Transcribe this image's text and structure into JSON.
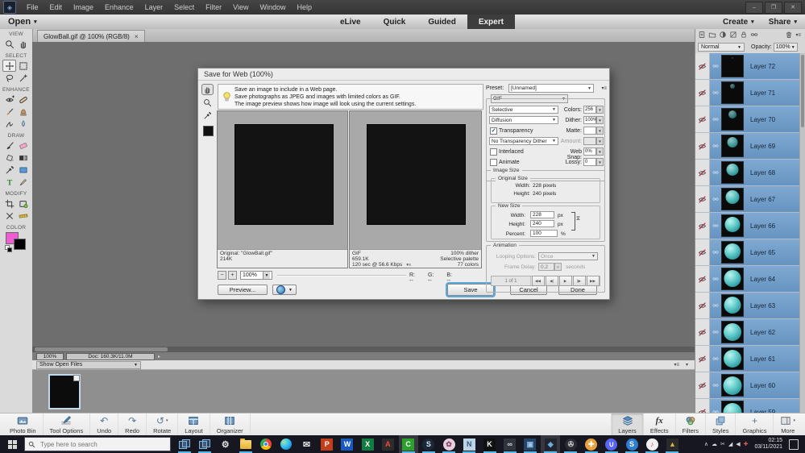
{
  "colors": {
    "accent_blue": "#5aa7dc",
    "layer_selection_blue": "#6f9dc9",
    "ball_teal": "#4fc3c3",
    "foreground_swatch": "#ee5ed2",
    "background_swatch": "#000000",
    "taskbar_background": "#171722"
  },
  "titlebar": {
    "menus": [
      "File",
      "Edit",
      "Image",
      "Enhance",
      "Layer",
      "Select",
      "Filter",
      "View",
      "Window",
      "Help"
    ],
    "window_controls": [
      {
        "name": "minimize-button",
        "glyph": "–"
      },
      {
        "name": "restore-button",
        "glyph": "❐"
      },
      {
        "name": "close-button",
        "glyph": "✕"
      }
    ]
  },
  "mode_bar": {
    "open_label": "Open",
    "tabs": [
      {
        "label": "eLive",
        "active": false
      },
      {
        "label": "Quick",
        "active": false
      },
      {
        "label": "Guided",
        "active": false
      },
      {
        "label": "Expert",
        "active": true
      }
    ],
    "create_label": "Create",
    "share_label": "Share"
  },
  "document_tab": {
    "title": "GlowBall.gif @ 100% (RGB/8)",
    "close_glyph": "×"
  },
  "tools_panel": {
    "sections": [
      {
        "label": "VIEW",
        "tools": [
          {
            "name": "zoom-tool",
            "icon": "magnifier"
          },
          {
            "name": "hand-tool",
            "icon": "hand"
          }
        ]
      },
      {
        "label": "SELECT",
        "tools": [
          {
            "name": "move-tool",
            "icon": "move",
            "selected": true
          },
          {
            "name": "marquee-tool",
            "icon": "marquee"
          },
          {
            "name": "lasso-tool",
            "icon": "lasso"
          },
          {
            "name": "quick-selection-tool",
            "icon": "wand"
          }
        ]
      },
      {
        "label": "ENHANCE",
        "tools": [
          {
            "name": "red-eye-removal-tool",
            "icon": "eye"
          },
          {
            "name": "spot-healing-tool",
            "icon": "bandage"
          },
          {
            "name": "smart-brush-tool",
            "icon": "brush2"
          },
          {
            "name": "clone-stamp-tool",
            "icon": "stamp"
          },
          {
            "name": "smudge-tool",
            "icon": "smudge"
          },
          {
            "name": "blur-tool",
            "icon": "blur"
          }
        ]
      },
      {
        "label": "DRAW",
        "tools": [
          {
            "name": "brush-tool",
            "icon": "brush"
          },
          {
            "name": "eraser-tool",
            "icon": "eraser"
          },
          {
            "name": "paint-bucket-tool",
            "icon": "bucket"
          },
          {
            "name": "gradient-tool",
            "icon": "gradient"
          },
          {
            "name": "eyedropper-tool",
            "icon": "eyedropper"
          },
          {
            "name": "shape-tool",
            "icon": "shape"
          },
          {
            "name": "type-tool",
            "icon": "type"
          },
          {
            "name": "pencil-tool",
            "icon": "pencil"
          }
        ]
      },
      {
        "label": "MODIFY",
        "tools": [
          {
            "name": "crop-tool",
            "icon": "crop"
          },
          {
            "name": "cookie-cutter-tool",
            "icon": "cookie"
          },
          {
            "name": "content-aware-move-tool",
            "icon": "camove"
          },
          {
            "name": "straighten-tool",
            "icon": "ruler"
          }
        ]
      }
    ],
    "color_section_label": "COLOR"
  },
  "dialog": {
    "title": "Save for Web (100%)",
    "info_lines": [
      "Save an image to include in a Web page.",
      "Save photographs as JPEG and images with limited colors as GIF.",
      "The image preview shows how image will look using the current settings."
    ],
    "tools": [
      {
        "name": "hand-tool",
        "icon": "hand",
        "selected": true
      },
      {
        "name": "zoom-tool",
        "icon": "magnifier"
      },
      {
        "name": "eyedropper-tool",
        "icon": "eyedropper"
      }
    ],
    "previews": {
      "original": {
        "lines": [
          "Original: \"GlowBall.gif\"",
          "214K"
        ]
      },
      "optimized": {
        "left_lines": [
          "GIF",
          "659.1K",
          "120 sec @ 56.6 Kbps"
        ],
        "menu_glyph": "▾≡",
        "right_lines": [
          "100% dither",
          "Selective palette",
          "77 colors"
        ]
      }
    },
    "zoom": {
      "minus": "−",
      "plus": "+",
      "value": "100%"
    },
    "rgb": {
      "r_label": "R:",
      "g_label": "G:",
      "b_label": "B:",
      "value": "--"
    },
    "buttons": {
      "preview": "Preview...",
      "save": "Save",
      "cancel": "Cancel",
      "done": "Done"
    },
    "preset": {
      "label": "Preset:",
      "value": "[Unnamed]",
      "menu_glyph": "▾≡"
    },
    "format_value": "GIF",
    "settings_rows": [
      {
        "name": "palette",
        "type": "select",
        "value": "Selective",
        "right_label": "Colors:",
        "right_value": "256"
      },
      {
        "name": "dither-method",
        "type": "select",
        "value": "Diffusion",
        "right_label": "Dither:",
        "right_value": "100%"
      },
      {
        "name": "transparency",
        "type": "checkbox",
        "value": "Transparency",
        "checked": true,
        "right_label": "Matte:",
        "right_value": ""
      },
      {
        "name": "transparency-dither",
        "type": "select",
        "value": "No Transparency Dither",
        "right_label": "Amount:",
        "right_value": "",
        "right_disabled": true
      },
      {
        "name": "interlaced",
        "type": "checkbox",
        "value": "Interlaced",
        "checked": false,
        "right_label": "Web Snap:",
        "right_value": "0%"
      },
      {
        "name": "animate",
        "type": "checkbox",
        "value": "Animate",
        "checked": false,
        "right_label": "Lossy:",
        "right_value": "0"
      }
    ],
    "image_size": {
      "legend": "Image Size",
      "original": {
        "legend": "Original Size",
        "width_label": "Width:",
        "width_value": "228 pixels",
        "height_label": "Height:",
        "height_value": "240 pixels"
      },
      "new": {
        "legend": "New Size",
        "width_label": "Width:",
        "width_value": "228",
        "height_label": "Height:",
        "height_value": "240",
        "unit": "px",
        "percent_label": "Percent:",
        "percent_value": "100",
        "percent_unit": "%"
      }
    },
    "animation": {
      "legend": "Animation",
      "loop_label": "Looping Options:",
      "loop_value": "Once",
      "delay_label": "Frame Delay:",
      "delay_value": "0.2",
      "delay_unit": "seconds",
      "frame_counter": "1 of 1",
      "controls": [
        {
          "name": "first-frame-button",
          "glyph": "◀◀"
        },
        {
          "name": "previous-frame-button",
          "glyph": "◀|"
        },
        {
          "name": "play-button",
          "glyph": "▶"
        },
        {
          "name": "next-frame-button",
          "glyph": "|▶"
        },
        {
          "name": "last-frame-button",
          "glyph": "▶▶"
        }
      ]
    }
  },
  "layers_panel": {
    "header_icons": [
      {
        "name": "new-layer-icon",
        "icon": "newlayer"
      },
      {
        "name": "new-group-icon",
        "icon": "newgroup"
      },
      {
        "name": "adjustment-layer-icon",
        "icon": "adjust"
      },
      {
        "name": "fill-layer-icon",
        "icon": "fill"
      },
      {
        "name": "lock-icon",
        "icon": "lock"
      },
      {
        "name": "link-layers-icon",
        "icon": "chain"
      }
    ],
    "trash_icon_name": "delete-layer-icon",
    "panel_menu_glyph": "▾≡",
    "blend_mode": "Normal",
    "opacity_label": "Opacity:",
    "opacity_value": "100%",
    "layers": [
      {
        "name": "Layer 72",
        "ball": 0.1,
        "glow": 0.28
      },
      {
        "name": "Layer 71",
        "ball": 0.26,
        "glow": 0.5
      },
      {
        "name": "Layer 70",
        "ball": 0.42,
        "glow": 0.65
      },
      {
        "name": "Layer 69",
        "ball": 0.56,
        "glow": 0.8
      },
      {
        "name": "Layer 68",
        "ball": 0.66,
        "glow": 0.9
      },
      {
        "name": "Layer 67",
        "ball": 0.74,
        "glow": 0.95
      },
      {
        "name": "Layer 66",
        "ball": 0.81,
        "glow": 1
      },
      {
        "name": "Layer 65",
        "ball": 0.86,
        "glow": 1
      },
      {
        "name": "Layer 64",
        "ball": 0.9,
        "glow": 1
      },
      {
        "name": "Layer 63",
        "ball": 0.93,
        "glow": 1
      },
      {
        "name": "Layer 62",
        "ball": 0.95,
        "glow": 1
      },
      {
        "name": "Layer 61",
        "ball": 0.97,
        "glow": 1
      },
      {
        "name": "Layer 60",
        "ball": 0.99,
        "glow": 1
      },
      {
        "name": "Layer 59",
        "ball": 1.0,
        "glow": 1
      }
    ]
  },
  "status_bar": {
    "zoom": "100%",
    "doc": "Doc: 160.3K/11.0M",
    "expander_glyph": "▸"
  },
  "photo_bin": {
    "selector_label": "Show Open Files",
    "menu_glyph": "▾≡",
    "collapse_glyph": "▾"
  },
  "pse_taskbar": {
    "left": [
      {
        "name": "photo-bin-button",
        "label": "Photo Bin",
        "icon": "photobin"
      },
      {
        "name": "tool-options-button",
        "label": "Tool Options",
        "icon": "tooloptions"
      },
      {
        "name": "undo-button",
        "label": "Undo",
        "glyph": "↶"
      },
      {
        "name": "redo-button",
        "label": "Redo",
        "glyph": "↷"
      },
      {
        "name": "rotate-button",
        "label": "Rotate",
        "glyph": "↺",
        "caret": true
      },
      {
        "name": "layout-button",
        "label": "Layout",
        "icon": "layout"
      },
      {
        "name": "organizer-button",
        "label": "Organizer",
        "icon": "organizer"
      }
    ],
    "right": [
      {
        "name": "layers-button",
        "label": "Layers",
        "icon": "layersico",
        "active": true
      },
      {
        "name": "effects-button",
        "label": "Effects",
        "glyph": "fx",
        "fx": true
      },
      {
        "name": "filters-button",
        "label": "Filters",
        "icon": "filters"
      },
      {
        "name": "styles-button",
        "label": "Styles",
        "icon": "styles"
      },
      {
        "name": "graphics-button",
        "label": "Graphics",
        "glyph": "+"
      },
      {
        "name": "more-button",
        "label": "More",
        "icon": "more",
        "caret": true
      }
    ]
  },
  "windows_taskbar": {
    "search_placeholder": "Type here to search",
    "icons": [
      {
        "name": "task-view-icon",
        "kind": "panes",
        "open": true
      },
      {
        "name": "virtual-desktop-icon",
        "kind": "panes",
        "open": true
      },
      {
        "name": "settings-icon",
        "kind": "glyph",
        "glyph": "⚙",
        "fg": "#e0e0e0",
        "open": false
      },
      {
        "name": "file-explorer-icon",
        "kind": "folder",
        "open": true
      },
      {
        "name": "chrome-icon",
        "kind": "chrome",
        "open": false
      },
      {
        "name": "edge-icon",
        "kind": "edge",
        "open": false
      },
      {
        "name": "mail-icon",
        "kind": "glyph",
        "glyph": "✉",
        "fg": "#e0e0e0",
        "open": false
      },
      {
        "name": "powerpoint-icon",
        "kind": "letter",
        "glyph": "P",
        "bg": "#c43e1c",
        "fg": "#ffffff",
        "open": false
      },
      {
        "name": "word-icon",
        "kind": "letter",
        "glyph": "W",
        "bg": "#185abd",
        "fg": "#ffffff",
        "open": false
      },
      {
        "name": "excel-icon",
        "kind": "letter",
        "glyph": "X",
        "bg": "#107c41",
        "fg": "#ffffff",
        "open": false
      },
      {
        "name": "acrobat-icon",
        "kind": "letter",
        "glyph": "A",
        "bg": "#2d2d2d",
        "fg": "#ff4438",
        "open": false
      },
      {
        "name": "camtasia-icon",
        "kind": "letter",
        "glyph": "C",
        "bg": "#2ba02b",
        "fg": "#ffffff",
        "open": true,
        "active": true
      },
      {
        "name": "steam-icon",
        "kind": "circle",
        "glyph": "S",
        "bg": "#1b2838",
        "fg": "#cfe3f3",
        "open": true
      },
      {
        "name": "paint-app-icon",
        "kind": "circle",
        "glyph": "✿",
        "bg": "#e8cfe0",
        "fg": "#8a4a6a",
        "open": true
      },
      {
        "name": "notes-app-icon",
        "kind": "letter",
        "glyph": "N",
        "bg": "#bcd4e8",
        "fg": "#3a5a7a",
        "open": true
      },
      {
        "name": "krita-icon",
        "kind": "letter",
        "glyph": "K",
        "bg": "#101010",
        "fg": "#ffffff",
        "open": true
      },
      {
        "name": "goggles-app-icon",
        "kind": "letter",
        "glyph": "∞",
        "bg": "#30343c",
        "fg": "#d8d8d8",
        "open": true
      },
      {
        "name": "system-app-icon",
        "kind": "letter",
        "glyph": "▣",
        "bg": "#23456a",
        "fg": "#9fc4e8",
        "open": true
      },
      {
        "name": "photoshop-elements-icon",
        "kind": "letter",
        "glyph": "◈",
        "bg": "#20242c",
        "fg": "#6fb4e8",
        "open": true,
        "active": true
      },
      {
        "name": "media-player-icon",
        "kind": "circle",
        "glyph": "✇",
        "bg": "#2a2a34",
        "fg": "#cccccc",
        "open": true
      },
      {
        "name": "security-app-icon",
        "kind": "circle",
        "glyph": "✚",
        "bg": "#e8a13c",
        "fg": "#ffffff",
        "open": true
      },
      {
        "name": "discord-icon",
        "kind": "circle",
        "glyph": "∪",
        "bg": "#5865f2",
        "fg": "#ffffff",
        "open": true
      },
      {
        "name": "skype-icon",
        "kind": "circle",
        "glyph": "S",
        "bg": "#2d7dd2",
        "fg": "#ffffff",
        "open": true
      },
      {
        "name": "itunes-icon",
        "kind": "circle",
        "glyph": "♪",
        "bg": "#f2f2f2",
        "fg": "#e84a6a",
        "open": true
      },
      {
        "name": "gallery-app-icon",
        "kind": "letter",
        "glyph": "▲",
        "bg": "#2a2a2a",
        "fg": "#d8b04a",
        "open": true
      }
    ],
    "tray_icons": [
      {
        "name": "tray-expand-icon",
        "glyph": "∧"
      },
      {
        "name": "onedrive-icon",
        "glyph": "☁"
      },
      {
        "name": "snip-icon",
        "glyph": "✂"
      },
      {
        "name": "network-icon",
        "glyph": "◢"
      },
      {
        "name": "volume-icon",
        "glyph": "◀"
      },
      {
        "name": "defender-icon",
        "glyph": "✚",
        "color": "#e05a4e"
      }
    ],
    "clock": {
      "time": "02:15",
      "date": "03/11/2021"
    }
  }
}
